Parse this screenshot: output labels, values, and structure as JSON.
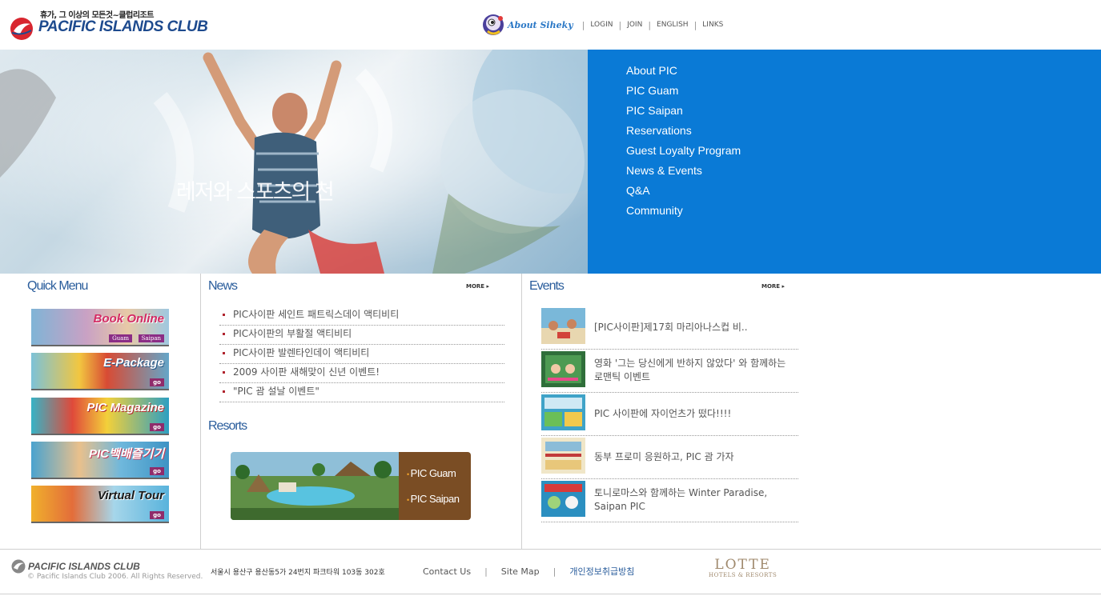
{
  "header": {
    "tagline": "휴가, 그 이상의 모든것~클럽리조트",
    "brand": "PACIFIC ISLANDS CLUB",
    "about_label": "About Siheky",
    "links": [
      "LOGIN",
      "JOIN",
      "ENGLISH",
      "LINKS"
    ]
  },
  "hero": {
    "caption": "레저와 스포츠의 천"
  },
  "main_nav": {
    "items": [
      "About PIC",
      "PIC Guam",
      "PIC Saipan",
      "Reservations",
      "Guest Loyalty Program",
      "News & Events",
      "Q&A",
      "Community"
    ]
  },
  "quick_menu": {
    "title": "Quick Menu",
    "items": [
      {
        "label": "Book Online",
        "sub1": "Guam",
        "sub2": "Saipan",
        "color": "#d42a63"
      },
      {
        "label": "E-Package",
        "badge": "go",
        "color": "#ffffff"
      },
      {
        "label": "PIC Magazine",
        "badge": "go",
        "color": "#ffffff"
      },
      {
        "label": "PIC백배즐기기",
        "badge": "go",
        "color": "#ffffff"
      },
      {
        "label": "Virtual Tour",
        "badge": "go",
        "color": "#1a1a1a"
      }
    ]
  },
  "news": {
    "title": "News",
    "more": "MORE",
    "items": [
      "PIC사이판 세인트 패트릭스데이 액티비티",
      "PIC사이판의 부활절 액티비티",
      "PIC사이판 발렌타인데이 액티비티",
      "2009 사이판 새해맞이 신년 이벤트!",
      "\"PIC 괌 설날 이벤트\""
    ]
  },
  "resorts": {
    "title": "Resorts",
    "links": [
      "PIC Guam",
      "PIC Saipan"
    ]
  },
  "events": {
    "title": "Events",
    "more": "MORE",
    "items": [
      "[PIC사이판]제17회 마리아나스컵 비..",
      "영화 '그는 당신에게 반하지 않았다' 와 함께하는 로맨틱 이벤트",
      "PIC 사이판에 자이언츠가 떴다!!!!",
      "동부 프로미 응원하고, PIC 괌 가자",
      "토니로마스와 함께하는 Winter Paradise, Saipan PIC"
    ]
  },
  "footer": {
    "brand": "PACIFIC ISLANDS CLUB",
    "copyright": "© Pacific Islands Club 2006. All Rights Reserved.",
    "address": "서울시 용산구 용산동5가 24번지 파크타워 103동 302호",
    "links": [
      "Contact Us",
      "Site Map",
      "개인정보취급방침"
    ],
    "partner_line1": "LOTTE",
    "partner_line2": "HOTELS & RESORTS"
  },
  "colors": {
    "nav_blue": "#0a7ad6",
    "title_blue": "#2a5d9c",
    "resort_brown": "#7a4d24",
    "bullet_red": "#b0242e"
  }
}
